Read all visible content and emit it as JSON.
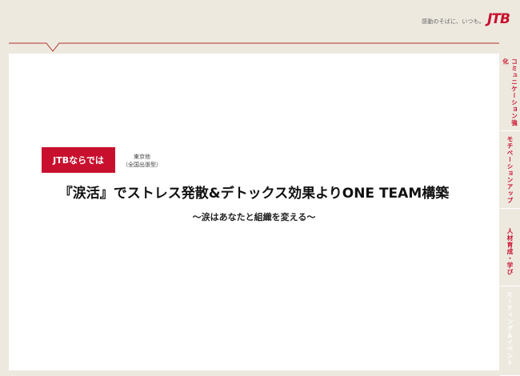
{
  "header": {
    "tagline": "感動のそばに、いつも。",
    "logo_text": "JTB"
  },
  "content": {
    "badge": "JTBならでは",
    "location_line1": "東京他",
    "location_line2": "（全国出張型）",
    "title": "『涙活』でストレス発散&デトックス効果よりONE TEAM構築",
    "subtitle": "～涙はあなたと組織を変える～"
  },
  "sidenav": {
    "items": [
      {
        "label": "コミュニケーション強化"
      },
      {
        "label": "モチベーションアップ"
      },
      {
        "label": "人材育成・学び"
      },
      {
        "label": "ミーティング＆イベント"
      }
    ]
  },
  "colors": {
    "accent": "#c8102e",
    "background": "#ede9df",
    "card": "#ffffff"
  }
}
